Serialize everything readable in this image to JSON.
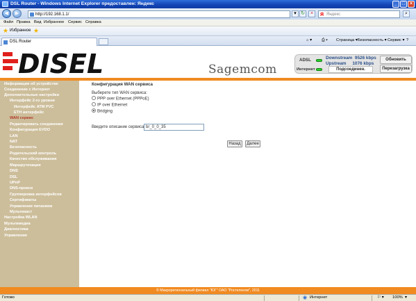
{
  "window": {
    "title": "DSL Router - Windows Internet Explorer предоставлен: Яндекс"
  },
  "address_bar": {
    "url": "http://192.168.1.1/",
    "search_placeholder": "Яндекс",
    "search_logo": "Я"
  },
  "menu": [
    "Файл",
    "Правка",
    "Вид",
    "Избранное",
    "Сервис",
    "Справка"
  ],
  "favorites": {
    "label": "Избранное"
  },
  "tab": {
    "title": "DSL Router"
  },
  "toolbar": {
    "page": "Страница ▾",
    "security": "Безопасность ▾",
    "tools": "Сервис ▾"
  },
  "header": {
    "brand": "DISEL",
    "partner": "Sagemcom",
    "adsl_label": "ADSL",
    "downstream_label": "Downstream",
    "downstream_value": "9526 kbps",
    "upstream_label": "Upstream",
    "upstream_value": "1076 kbps",
    "internet_label": "Интернет",
    "connection_state": "Подсоединен.",
    "update_button": "Обновить",
    "reboot_button": "Перезагрузка"
  },
  "sidebar": {
    "items": [
      {
        "label": "Информация об устройстве",
        "level": 0
      },
      {
        "label": "Соединение с Интернет",
        "level": 0
      },
      {
        "label": "Дополнительные настройки",
        "level": 0
      },
      {
        "label": "Интерфейс 2-го уровня",
        "level": 2
      },
      {
        "label": "Интерфейс ATM PVC",
        "level": 3
      },
      {
        "label": "ETH интерфейс",
        "level": 3
      },
      {
        "label": "WAN сервис",
        "level": 1,
        "active": true
      },
      {
        "label": "Редактировать соединения",
        "level": 1
      },
      {
        "label": "Конфигурация EVDO",
        "level": 1
      },
      {
        "label": "LAN",
        "level": 1
      },
      {
        "label": "NAT",
        "level": 1
      },
      {
        "label": "Безопасность",
        "level": 1
      },
      {
        "label": "Родительский контроль",
        "level": 1
      },
      {
        "label": "Качество обслуживания",
        "level": 1
      },
      {
        "label": "Маршрутизация",
        "level": 1
      },
      {
        "label": "DNS",
        "level": 1
      },
      {
        "label": "DSL",
        "level": 1
      },
      {
        "label": "UPnP",
        "level": 1
      },
      {
        "label": "DNS-прокси",
        "level": 1
      },
      {
        "label": "Группировка интерфейсов",
        "level": 1
      },
      {
        "label": "Сертификаты",
        "level": 1
      },
      {
        "label": "Управление питанием",
        "level": 1
      },
      {
        "label": "Мультикаст",
        "level": 1
      },
      {
        "label": "Настройка WLAN",
        "level": 0
      },
      {
        "label": "Мультимедиа",
        "level": 0
      },
      {
        "label": "Диагностика",
        "level": 0
      },
      {
        "label": "Управление",
        "level": 0
      }
    ]
  },
  "form": {
    "title": "Конфигурация WAN сервиса",
    "prompt": "Выберете тип WAN сервиса:",
    "options": [
      {
        "label": "PPP over Ethernet (PPPoE)",
        "selected": false
      },
      {
        "label": "IP over Ethernet",
        "selected": false
      },
      {
        "label": "Bridging",
        "selected": true
      }
    ],
    "description_label": "Введите описание сервиса:",
    "description_value": "br_0_0_35",
    "back_button": "Назад",
    "next_button": "Далее"
  },
  "footer": {
    "text": "© Макрорегиональный филиал \"ЮГ\" ОАО \"Ростелеком\", 2011"
  },
  "statusbar": {
    "left": "Готово",
    "zone": "Интернет",
    "zoom": "100%"
  },
  "colors": {
    "accent": "#f18a21",
    "sidebar": "#cdbe9b",
    "active_item": "#b13c2a",
    "brand_red": "#e0201c"
  }
}
